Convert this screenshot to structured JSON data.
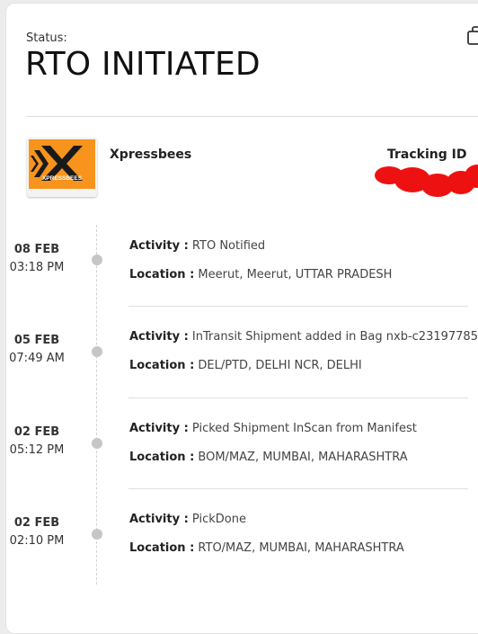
{
  "status": {
    "label": "Status:",
    "value": "RTO INITIATED"
  },
  "icons": {
    "copy": "copy-icon"
  },
  "courier": {
    "name": "Xpressbees",
    "logo_text": "XPRESSBEES",
    "logo_color": "#f7941d",
    "tracking_label": "Tracking ID"
  },
  "timeline": [
    {
      "date": "08 FEB",
      "time": "03:18 PM",
      "activity_label": "Activity :",
      "activity": "RTO Notified",
      "location_label": "Location :",
      "location": "Meerut, Meerut, UTTAR PRADESH"
    },
    {
      "date": "05 FEB",
      "time": "07:49 AM",
      "activity_label": "Activity :",
      "activity": "InTransit Shipment added in Bag nxb-c23197785",
      "location_label": "Location :",
      "location": "DEL/PTD, DELHI NCR, DELHI"
    },
    {
      "date": "02 FEB",
      "time": "05:12 PM",
      "activity_label": "Activity :",
      "activity": "Picked Shipment InScan from Manifest",
      "location_label": "Location :",
      "location": "BOM/MAZ, MUMBAI, MAHARASHTRA"
    },
    {
      "date": "02 FEB",
      "time": "02:10 PM",
      "activity_label": "Activity :",
      "activity": "PickDone",
      "location_label": "Location :",
      "location": "RTO/MAZ, MUMBAI, MAHARASHTRA"
    }
  ]
}
